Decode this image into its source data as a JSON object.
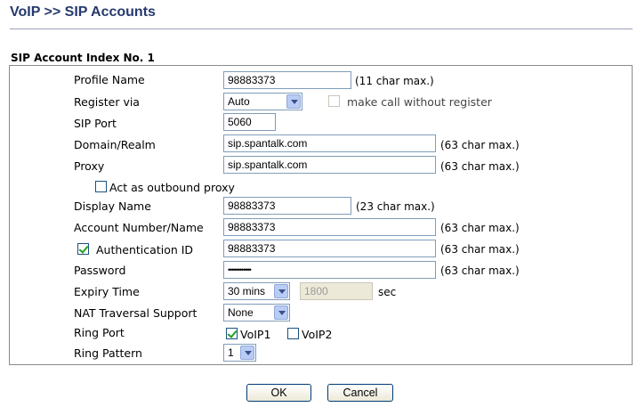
{
  "header": {
    "title": "VoIP >> SIP Accounts"
  },
  "section": {
    "title": "SIP Account Index No. 1"
  },
  "form": {
    "profile_name": {
      "label": "Profile Name",
      "value": "98883373",
      "hint": "(11 char max.)"
    },
    "register_via": {
      "label": "Register via",
      "selected": "Auto",
      "checkbox_label": "make call without register",
      "checked": false
    },
    "sip_port": {
      "label": "SIP Port",
      "value": "5060"
    },
    "domain_realm": {
      "label": "Domain/Realm",
      "value": "sip.spantalk.com",
      "hint": "(63 char max.)"
    },
    "proxy": {
      "label": "Proxy",
      "value": "sip.spantalk.com",
      "hint": "(63 char max.)"
    },
    "outbound_proxy": {
      "label": "Act as outbound proxy",
      "checked": false
    },
    "display_name": {
      "label": "Display Name",
      "value": "98883373",
      "hint": "(23 char max.)"
    },
    "account_number": {
      "label": "Account Number/Name",
      "value": "98883373",
      "hint": "(63 char max.)"
    },
    "authentication_id": {
      "label": "Authentication ID",
      "checked": true,
      "value": "98883373",
      "hint": "(63 char max.)"
    },
    "password": {
      "label": "Password",
      "value": "••••••••••••",
      "hint": "(63 char max.)"
    },
    "expiry_time": {
      "label": "Expiry Time",
      "selected": "30 mins",
      "value": "1800",
      "unit": "sec"
    },
    "nat_traversal": {
      "label": "NAT Traversal Support",
      "selected": "None"
    },
    "ring_port": {
      "label": "Ring Port",
      "voip1_label": "VoIP1",
      "voip1_checked": true,
      "voip2_label": "VoIP2",
      "voip2_checked": false
    },
    "ring_pattern": {
      "label": "Ring Pattern",
      "selected": "1"
    }
  },
  "buttons": {
    "ok": "OK",
    "cancel": "Cancel"
  }
}
